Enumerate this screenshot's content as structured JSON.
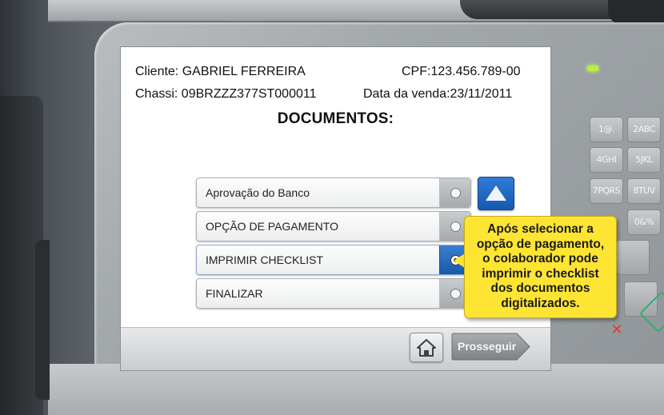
{
  "customer": {
    "client_label": "Cliente: GABRIEL FERREIRA",
    "cpf_label": "CPF:123.456.789-00",
    "chassis_label": "Chassi: 09BRZZZ377ST000011",
    "sale_date_label": "Data da venda:23/11/2011"
  },
  "screen_title": "DOCUMENTOS:",
  "options": [
    {
      "label": "Aprovação do Banco",
      "selected": false
    },
    {
      "label": "OPÇÃO DE PAGAMENTO",
      "selected": false
    },
    {
      "label": "IMPRIMIR CHECKLIST",
      "selected": true
    },
    {
      "label": "FINALIZAR",
      "selected": false
    }
  ],
  "footer": {
    "proceed_label": "Prosseguir"
  },
  "callout": {
    "text": "Após selecionar a\nopção de pagamento,\no colaborador pode\nimprimir o checklist\ndos documentos\ndigitalizados."
  },
  "keypad": {
    "keys": [
      "1@.",
      "2ABC",
      "4GHI",
      "5JKL",
      "7PQRS",
      "8TUV",
      "0&%"
    ],
    "cancel_symbol": "✕"
  },
  "colors": {
    "accent_blue": "#1b63bf",
    "callout_yellow": "#ffe533",
    "led_green": "#b6f03c",
    "cancel_red": "#e03a2a"
  },
  "icons": {
    "up_button": "up-arrow-icon",
    "home_button": "home-icon",
    "proceed_button": "arrow-right-icon"
  }
}
